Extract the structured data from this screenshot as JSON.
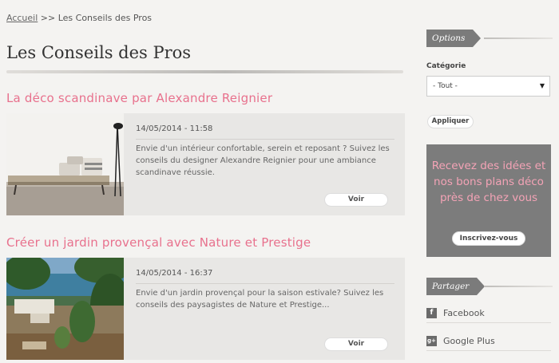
{
  "breadcrumb": {
    "home": "Accueil",
    "separator": " >> ",
    "current": "Les Conseils des Pros"
  },
  "page_title": "Les Conseils des Pros",
  "articles": [
    {
      "title": "La déco scandinave par Alexandre Reignier",
      "date": "14/05/2014 - 11:58",
      "excerpt": "Envie d'un intérieur confortable, serein et reposant ? Suivez les conseils du designer Alexandre Reignier pour une ambiance scandinave réussie.",
      "button": "Voir"
    },
    {
      "title": "Créer un jardin provençal avec Nature et Prestige",
      "date": "14/05/2014 - 16:37",
      "excerpt": "Envie d'un jardin provençal pour la saison estivale? Suivez les conseils des paysagistes de Nature et Prestige...",
      "button": "Voir"
    }
  ],
  "sidebar": {
    "options_heading": "Options",
    "category_label": "Catégorie",
    "category_selected": "- Tout -",
    "apply_button": "Appliquer",
    "promo_text": "Recevez des idées et nos bons plans déco près de chez vous",
    "promo_button": "Inscrivez-vous",
    "share_heading": "Partager",
    "share_items": [
      {
        "icon": "facebook-icon",
        "glyph": "f",
        "label": "Facebook"
      },
      {
        "icon": "google-plus-icon",
        "glyph": "g+",
        "label": "Google Plus"
      }
    ]
  },
  "colors": {
    "accent_pink": "#e8718d",
    "promo_bg": "#7c7c7c",
    "promo_text": "#f4a3b6"
  }
}
